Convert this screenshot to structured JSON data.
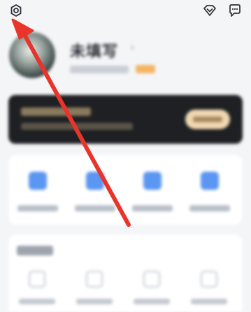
{
  "profile": {
    "name": "未填写",
    "name_arrow": "›"
  },
  "top_icons": [
    "gear-icon",
    "heart-diamond-icon",
    "chat-bubble-icon"
  ],
  "colors": {
    "annotation_arrow": "#e8342b",
    "vip_card_bg": "#1f2023",
    "vip_button": "#f0d7b2",
    "shortcut_icon": "#5b96f2",
    "badge": "#f3b563"
  }
}
